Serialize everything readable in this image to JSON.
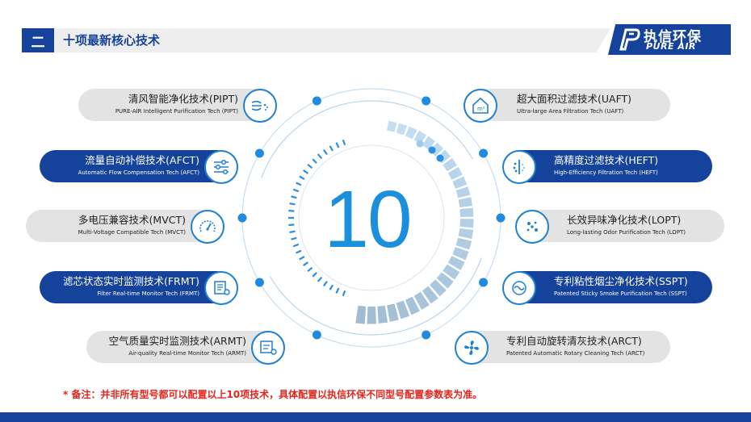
{
  "header": {
    "section_number": "二",
    "title": "十项最新核心技术",
    "logo_cn": "执信环保",
    "logo_en": "PURE AIR"
  },
  "center_number": "10",
  "features_left": [
    {
      "title": "清风智能净化技术(PIPT)",
      "subtitle": "PURE-AIR Intelligent Purification Tech (PIPT)",
      "icon": "wind-breeze-icon",
      "style": "light"
    },
    {
      "title": "流量自动补偿技术(AFCT)",
      "subtitle": "Automatic Flow Compensation Tech (AFCT)",
      "icon": "sliders-icon",
      "style": "dark"
    },
    {
      "title": "多电压兼容技术(MVCT)",
      "subtitle": "Multi-Voltage Compatible Tech (MVCT)",
      "icon": "gauge-icon",
      "style": "light"
    },
    {
      "title": "滤芯状态实时监测技术(FRMT)",
      "subtitle": "Filter Real-time Monitor Tech (FRMT)",
      "icon": "filter-monitor-icon",
      "style": "dark"
    },
    {
      "title": "空气质量实时监测技术(ARMT)",
      "subtitle": "Air-quality Real-time Monitor Tech (ARMT)",
      "icon": "pm25-monitor-icon",
      "style": "light"
    }
  ],
  "features_right": [
    {
      "title": "超大面积过滤技术(UAFT)",
      "subtitle": "Ultra-large Area Filtration Tech (UAFT)",
      "icon": "house-area-icon",
      "style": "light"
    },
    {
      "title": "高精度过滤技术(HEFT)",
      "subtitle": "High-Efficiency Filtration Tech (HEFT)",
      "icon": "hepa-filter-icon",
      "style": "dark"
    },
    {
      "title": "长效异味净化技术(LOPT)",
      "subtitle": "Long-lasting Odor Purification Tech (LOPT)",
      "icon": "odor-particles-icon",
      "style": "light"
    },
    {
      "title": "专利粘性烟尘净化技术(SSPT)",
      "subtitle": "Patented Sticky Smoke Purification Tech (SSPT)",
      "icon": "smoke-icon",
      "style": "dark"
    },
    {
      "title": "专利自动旋转清灰技术(ARCT)",
      "subtitle": "Patented Automatic Rotary Cleaning Tech (ARCT)",
      "icon": "rotary-fan-icon",
      "style": "light"
    }
  ],
  "colors": {
    "brand_blue": "#15439b",
    "accent_blue": "#1f7fd0",
    "pill_gray": "#e3e3e3",
    "note_red": "#e3251b"
  },
  "note": "* 备注：并非所有型号都可以配置以上10项技术，具体配置以执信环保不同型号配置参数表为准。"
}
